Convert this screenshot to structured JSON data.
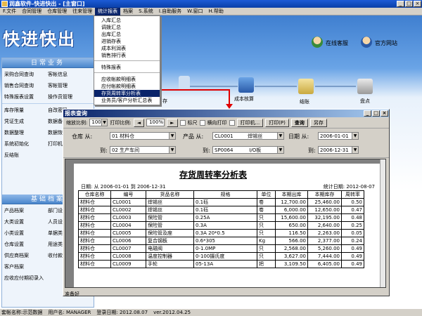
{
  "window": {
    "title": "润鑫软件-快进快出 - [主窗口]",
    "min": "_",
    "max": "□",
    "close": "×"
  },
  "menu": [
    "F.文件",
    "合同管理",
    "仓库管理",
    "往来管理",
    "统计报表",
    "档案",
    "S.系统",
    "I.自助服务",
    "W.窗口",
    "H.帮助"
  ],
  "dropdown": {
    "items": [
      "入库汇总",
      "调拨汇总",
      "出库汇总",
      "进销存表",
      "成本利润表",
      "销售排行表"
    ],
    "group2": [
      "特殊报表"
    ],
    "group3": [
      "应收帐款明细表",
      "应付帐款明细表",
      "存货周转率分析表",
      "业务员/客户分析汇总表"
    ],
    "selected": "存货周转率分析表"
  },
  "logo": "快进快出",
  "top_links": {
    "online": "在线客服",
    "site": "官方网站"
  },
  "flow": {
    "cost": "成本核算",
    "settle": "结账",
    "inventory": "盘点",
    "partial": "存"
  },
  "left": {
    "daily_title": "日常业务",
    "daily": [
      [
        "采购合同查询",
        "客帐信息"
      ],
      [
        "销售合同查询",
        "客帐管理"
      ],
      [
        "特殊报表设置",
        "操作员管理"
      ]
    ],
    "daily2": [
      [
        "库存限量",
        "自改密码"
      ],
      [
        "凭证生成",
        "数据备份"
      ],
      [
        "数据整理",
        "数据恢复"
      ],
      [
        "系统初始化",
        "打印机设置"
      ],
      [
        "反结账",
        ""
      ]
    ],
    "base_title": "基础档案",
    "base": [
      [
        "产品档案",
        "部门设置"
      ],
      [
        "大类设置",
        "人员设置"
      ],
      [
        "小类设置",
        "单据类型"
      ],
      [
        "仓库设置",
        "用途类型"
      ],
      [
        "供应商档案",
        "收付款方式"
      ],
      [
        "客户档案",
        ""
      ],
      [
        "应收应付期初录入",
        ""
      ]
    ]
  },
  "report": {
    "title": "报表查询",
    "toolbar": {
      "zoom_label": "缩放比例:",
      "zoom_value": "100",
      "print_scale_label": "打印比例:",
      "print_scale_value": "100%",
      "ruler": "标尺",
      "landscape": "横向打印",
      "printer_btn": "打印机...",
      "print_btn": "打印(P)",
      "query_btn": "查询",
      "save_btn": "另存"
    },
    "filters": {
      "warehouse_from_label": "仓库 从:",
      "warehouse_from": "01    材料仓",
      "warehouse_to_label": "到:",
      "warehouse_to": "02    生产车间",
      "product_from_label": "产品 从:",
      "product_from_code": "CL0001",
      "product_from_name": "焊锡丝",
      "product_to_label": "到:",
      "product_to_code": "SP0064",
      "product_to_name": "I/O板",
      "date_from_label": "日期 从:",
      "date_from": "2006-01-01",
      "date_to_label": "到:",
      "date_to": "2006-12-31"
    },
    "sheet": {
      "title": "存货周转率分析表",
      "date_range": "日期: 从 2006-01-01 到  2006-12-31",
      "stat_date": "统计日期:   2012-08-07",
      "columns": [
        "仓库名称",
        "编号",
        "货品名称",
        "规格",
        "单位",
        "本期出库",
        "本期库存",
        "周转率"
      ],
      "rows": [
        [
          "材料仓",
          "CL0001",
          "焊锡丝",
          "0.1砡",
          "卷",
          "12,700.00",
          "25,460.00",
          "0.50"
        ],
        [
          "材料仓",
          "CL0002",
          "焊锡丝",
          "0.1砡",
          "卷",
          "6,000.00",
          "12,650.00",
          "0.47"
        ],
        [
          "材料仓",
          "CL0003",
          "保险管",
          "0.25A",
          "只",
          "15,600.00",
          "32,195.00",
          "0.48"
        ],
        [
          "材料仓",
          "CL0004",
          "保险管",
          "0.3A",
          "只",
          "650.00",
          "2,640.00",
          "0.25"
        ],
        [
          "材料仓",
          "CL0005",
          "保险管及座",
          "0.3A 20*0.5",
          "只",
          "116.50",
          "2,263.00",
          "0.05"
        ],
        [
          "材料仓",
          "CL0006",
          "复合钢板",
          "0.6*305",
          "Kg",
          "566.00",
          "2,377.00",
          "0.24"
        ],
        [
          "材料仓",
          "CL0007",
          "电磁阀",
          "0-1.0MP",
          "只",
          "2,568.00",
          "5,260.00",
          "0.49"
        ],
        [
          "材料仓",
          "CL0008",
          "温度控制器",
          "0-100摄氏度",
          "只",
          "3,627.00",
          "7,444.00",
          "0.49"
        ],
        [
          "材料仓",
          "CL0009",
          "手轮",
          "05-13A",
          "把",
          "3,109.50",
          "6,405.00",
          "0.49"
        ]
      ]
    },
    "status": "准备好"
  },
  "statusbar": {
    "account": "套帐名称:示范数据",
    "user": "用户名: MANAGER",
    "login": "登录日期: 2012.08.07",
    "version": "ver.2012.04.25"
  }
}
